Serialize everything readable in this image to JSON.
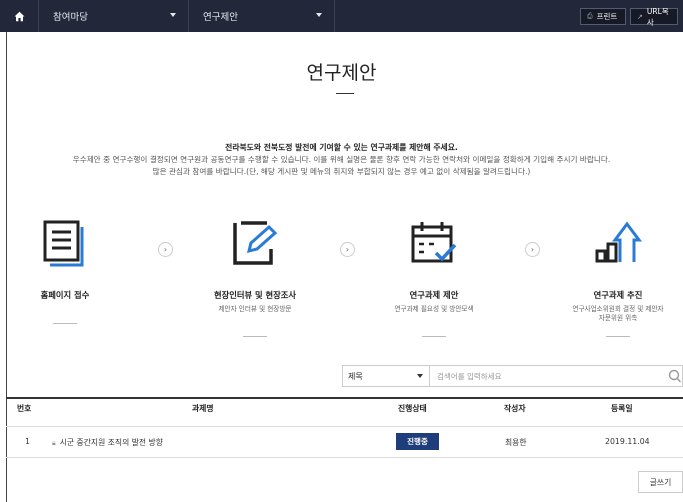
{
  "topnav": {
    "menu1": "참여마당",
    "menu2": "연구제안",
    "print_label": "프린트",
    "url_label": "URL복사"
  },
  "page": {
    "title": "연구제안",
    "intro_line1": "전라북도와 전북도정 발전에 기여할 수 있는 연구과제를 제안해 주세요.",
    "intro_line2": "우수제안 중 연구수행이 결정되면 연구원과 공동연구를 수행할 수 있습니다. 이를 위해 실명은 물론 향후 연락 가능한 연락처와 이메일을 정확하게 기입해 주시기 바랍니다.",
    "intro_line3": "많은 관심과 참여를 바랍니다.(단, 해당 게시판 및 메뉴의 취지와 부합되지 않는 경우 예고 없이 삭제됨을 알려드립니다.)"
  },
  "steps": [
    {
      "title": "홈페이지 접수",
      "desc1": "",
      "desc2": ""
    },
    {
      "title": "현장인터뷰 및 현장조사",
      "desc1": "제안자 인터뷰 및 현장방문",
      "desc2": ""
    },
    {
      "title": "연구과제 제안",
      "desc1": "연구과제 필요성 및 방안모색",
      "desc2": ""
    },
    {
      "title": "연구과제 추진",
      "desc1": "연구사업소위원회 결정 및 제안자",
      "desc2": "자문위원 위촉"
    }
  ],
  "search": {
    "select_value": "제목",
    "placeholder": "검색어를 입력하세요"
  },
  "table": {
    "headers": [
      "번호",
      "과제명",
      "진행상태",
      "작성자",
      "등록일"
    ],
    "rows": [
      {
        "no": "1",
        "title": "시군 중간지원 조직의 발전 방향",
        "status": "진행중",
        "author": "최용한",
        "date": "2019.11.04"
      }
    ]
  },
  "write_label": "글쓰기",
  "colors": {
    "nav": "#22283a",
    "badge": "#1e3d7a",
    "icon_blue": "#2a7bd6"
  }
}
